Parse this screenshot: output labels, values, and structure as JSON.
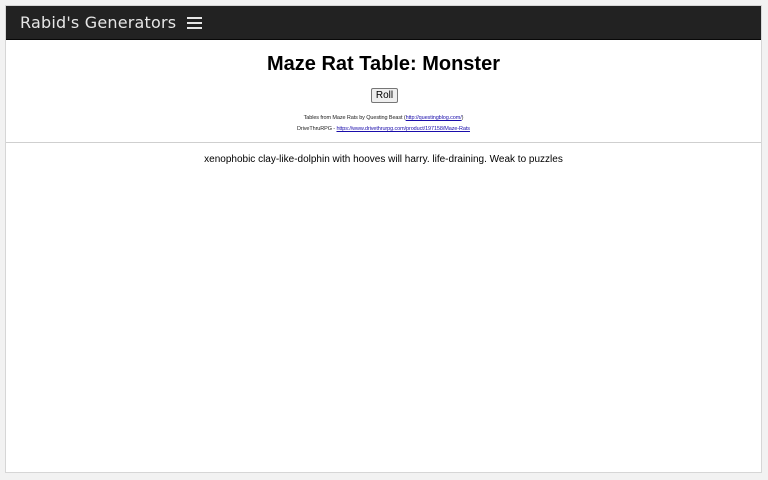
{
  "navbar": {
    "brand": "Rabid's Generators",
    "menu_icon": "hamburger-menu-icon"
  },
  "page": {
    "title": "Maze Rat Table: Monster",
    "roll_label": "Roll"
  },
  "credits": {
    "line1_prefix": "Tables from Maze Rats by Questing Beast (",
    "line1_link": "http://questingblog.com/",
    "line1_suffix": ")",
    "line2_prefix": "DriveThruRPG - ",
    "line2_link": "https://www.drivethrurpg.com/product/197158/Maze-Rats"
  },
  "result": {
    "text": "xenophobic clay-like-dolphin with hooves will harry. life-draining. Weak to puzzles"
  },
  "colors": {
    "navbar_bg": "#222222",
    "brand_text": "#e6e6e6",
    "link": "#1a0dab"
  }
}
